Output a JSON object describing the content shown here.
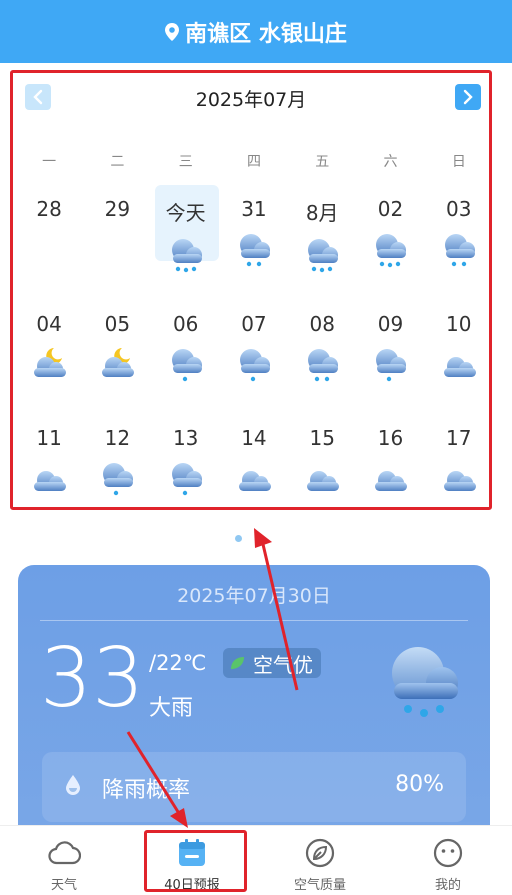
{
  "header": {
    "location": "南谯区 水银山庄",
    "icon": "location-pin-icon"
  },
  "calendar": {
    "month_title": "2025年07月",
    "weekdays": [
      "一",
      "二",
      "三",
      "四",
      "五",
      "六",
      "日"
    ],
    "days": [
      {
        "label": "28",
        "icon": null
      },
      {
        "label": "29",
        "icon": null
      },
      {
        "label": "今天",
        "icon": "heavy-rain",
        "today": true
      },
      {
        "label": "31",
        "icon": "rain"
      },
      {
        "label": "8月",
        "icon": "heavy-rain"
      },
      {
        "label": "02",
        "icon": "heavy-rain"
      },
      {
        "label": "03",
        "icon": "rain"
      },
      {
        "label": "04",
        "icon": "partly-cloudy-night"
      },
      {
        "label": "05",
        "icon": "partly-cloudy-night"
      },
      {
        "label": "06",
        "icon": "light-rain"
      },
      {
        "label": "07",
        "icon": "light-rain"
      },
      {
        "label": "08",
        "icon": "rain"
      },
      {
        "label": "09",
        "icon": "light-rain"
      },
      {
        "label": "10",
        "icon": "cloudy"
      },
      {
        "label": "11",
        "icon": "cloudy"
      },
      {
        "label": "12",
        "icon": "light-rain"
      },
      {
        "label": "13",
        "icon": "light-rain"
      },
      {
        "label": "14",
        "icon": "cloudy"
      },
      {
        "label": "15",
        "icon": "cloudy"
      },
      {
        "label": "16",
        "icon": "cloudy"
      },
      {
        "label": "17",
        "icon": "cloudy"
      }
    ]
  },
  "detail": {
    "date": "2025年07月30日",
    "temp": "33",
    "low": "/22℃",
    "air_quality": "空气优",
    "description": "大雨",
    "rain_label": "降雨概率",
    "rain_value": "80%"
  },
  "tabs": [
    {
      "label": "天气",
      "icon": "cloud-icon"
    },
    {
      "label": "40日预报",
      "icon": "calendar-icon",
      "active": true
    },
    {
      "label": "空气质量",
      "icon": "leaf-icon"
    },
    {
      "label": "我的",
      "icon": "face-icon"
    }
  ],
  "colors": {
    "primary": "#3fa8f5",
    "highlight": "#e0232b",
    "card": "#6d9fe6"
  }
}
